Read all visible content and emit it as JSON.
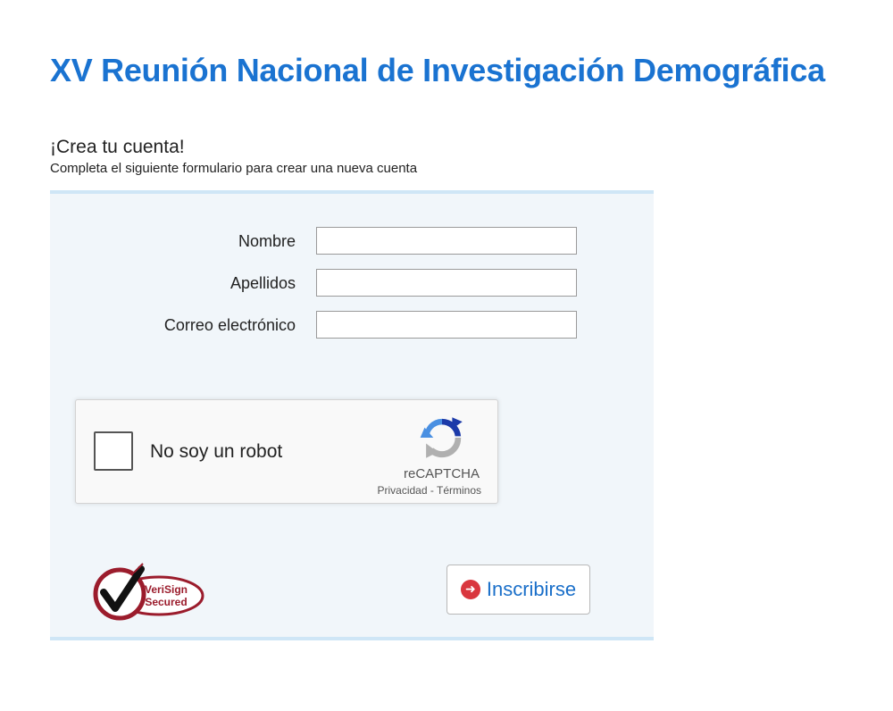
{
  "page": {
    "title": "XV Reunión Nacional de Investigación Demográfica"
  },
  "section": {
    "title": "¡Crea tu cuenta!",
    "subtitle": "Completa el siguiente formulario para crear una nueva cuenta"
  },
  "form": {
    "fields": [
      {
        "label": "Nombre",
        "value": ""
      },
      {
        "label": "Apellidos",
        "value": ""
      },
      {
        "label": "Correo electrónico",
        "value": ""
      }
    ],
    "submit_label": "Inscribirse",
    "submit_icon": "arrow-circle-right-icon"
  },
  "recaptcha": {
    "label": "No soy un robot",
    "brand": "reCAPTCHA",
    "privacy": "Privacidad",
    "separator": " - ",
    "terms": "Términos",
    "checked": false
  },
  "seal": {
    "line1": "VeriSign",
    "line2": "Secured"
  },
  "colors": {
    "title_blue": "#1a73d1",
    "panel_bg": "#f1f6fa",
    "panel_border": "#cfe6f6",
    "seal_red": "#9b1c2c",
    "submit_icon_red": "#d9363e"
  }
}
